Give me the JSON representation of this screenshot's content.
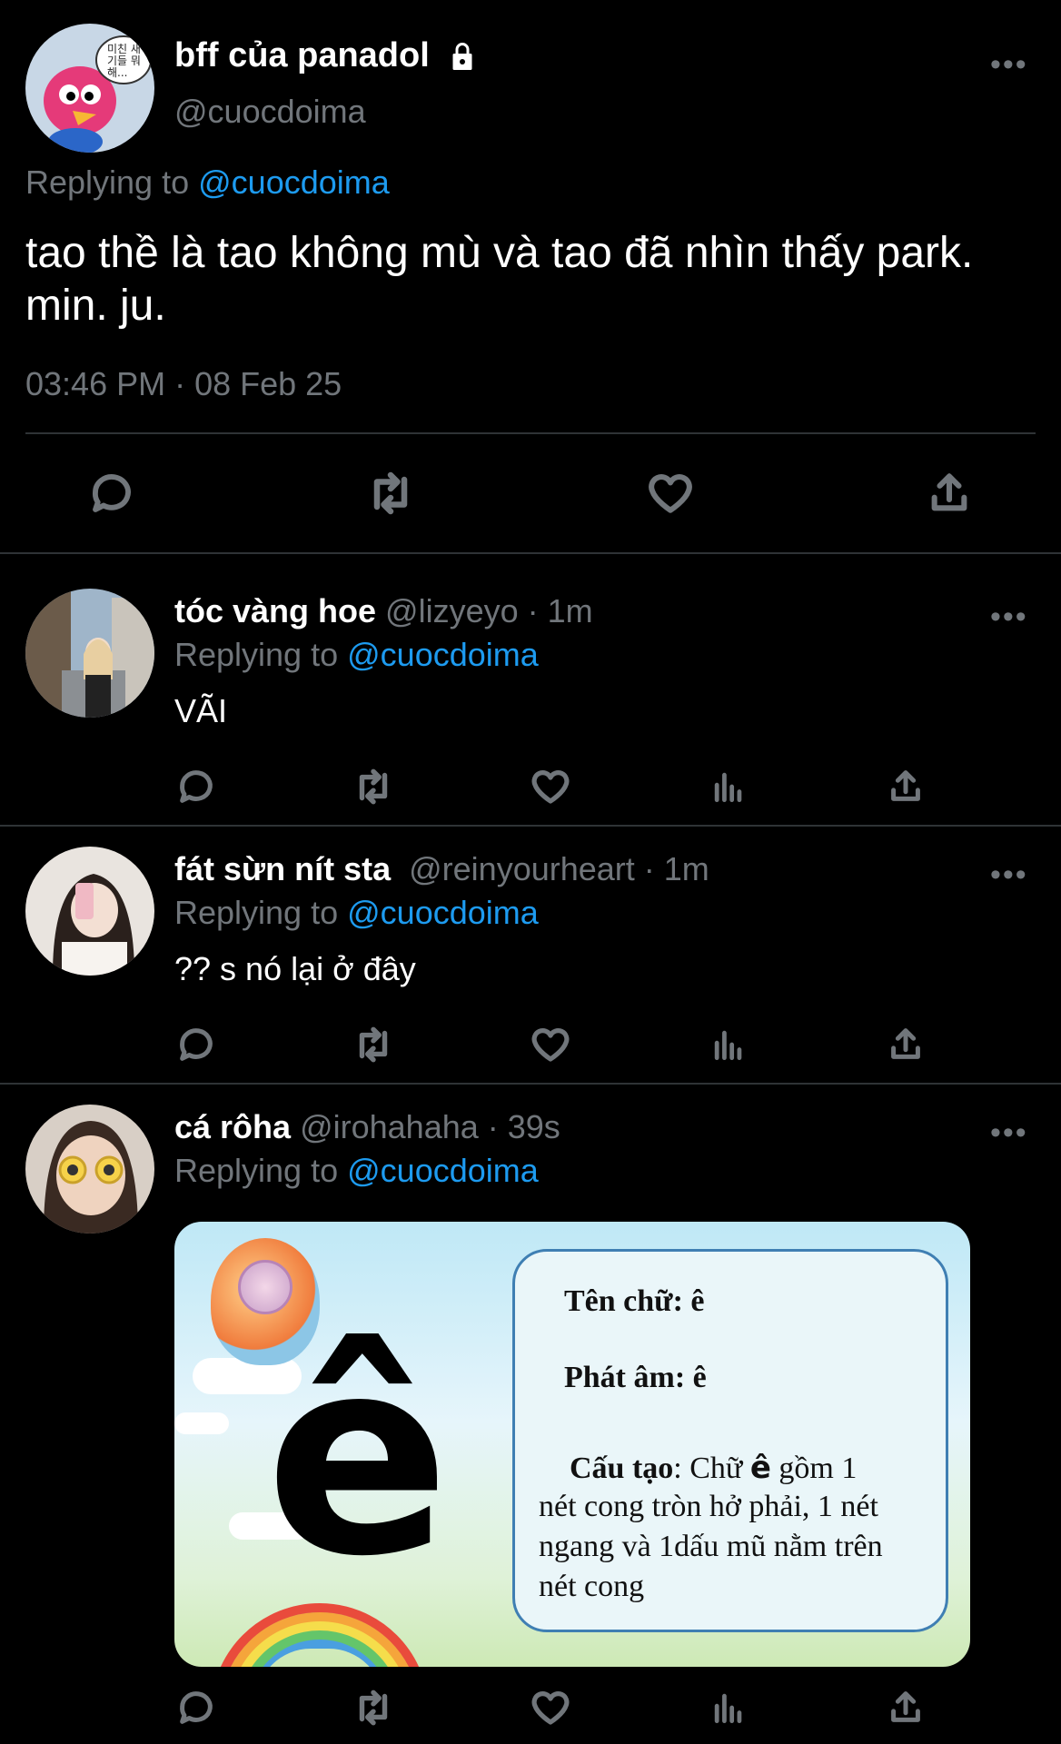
{
  "main_tweet": {
    "display_name": "bff của panadol",
    "handle": "@cuocdoima",
    "replying_prefix": "Replying to",
    "replying_to": "@cuocdoima",
    "text": "tao thề là tao không mù và tao đã nhìn thấy park. min. ju.",
    "timestamp": "03:46 PM · 08 Feb 25",
    "avatar_bubble_text": "미친 새기들 뭐해..."
  },
  "replies": [
    {
      "display_name": "tóc vàng hoe",
      "meta": "@lizyeyo · 1m",
      "replying_prefix": "Replying to",
      "replying_to": "@cuocdoima",
      "text": "VÃI"
    },
    {
      "display_name": "fát sừn nít sta",
      "meta": "@reinyourheart · 1m",
      "replying_prefix": "Replying to",
      "replying_to": "@cuocdoima",
      "text": "?? s nó lại ở đây"
    },
    {
      "display_name": "cá rôha",
      "meta": "@irohahaha · 39s",
      "replying_prefix": "Replying to",
      "replying_to": "@cuocdoima",
      "card": {
        "big_letter": "ê",
        "line1_label": "Tên chữ:",
        "line1_value": "ê",
        "line2_label": "Phát âm:",
        "line2_value": "ê",
        "line3_label": "Cấu tạo",
        "line3_a": ": Chữ",
        "line3_letter": "ê",
        "line3_b": "gồm 1",
        "line4": "nét cong tròn hở phải,  1 nét",
        "line5": "ngang và 1dấu mũ nằm trên",
        "line6": "nét cong"
      }
    }
  ],
  "more_label": "•••",
  "colors": {
    "background": "#000000",
    "link": "#1d9bf0",
    "muted": "#71767b"
  }
}
